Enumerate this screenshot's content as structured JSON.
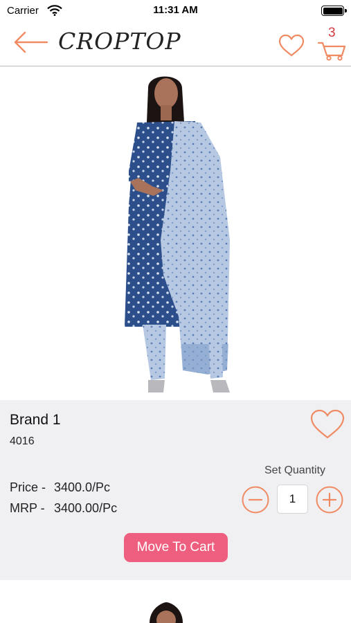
{
  "status_bar": {
    "carrier": "Carrier",
    "time": "11:31 AM",
    "icons": [
      "wifi-icon",
      "battery-icon"
    ]
  },
  "nav": {
    "logo": "CROPTOP",
    "cart_count": "3",
    "icons": [
      "back-arrow-icon",
      "heart-icon",
      "cart-icon"
    ],
    "accent_color": "#f08a62",
    "badge_color": "#d7393f"
  },
  "product": {
    "image": "woman-in-blue-printed-kurta-set-photo",
    "brand": "Brand 1",
    "code": "4016",
    "price_label": "Price -",
    "price_value": "3400.0/Pc",
    "mrp_label": "MRP -",
    "mrp_value": "3400.00/Pc",
    "quantity_label": "Set Quantity",
    "quantity": "1",
    "move_to_cart_label": "Move To Cart",
    "button_color": "#ee5e7e"
  }
}
